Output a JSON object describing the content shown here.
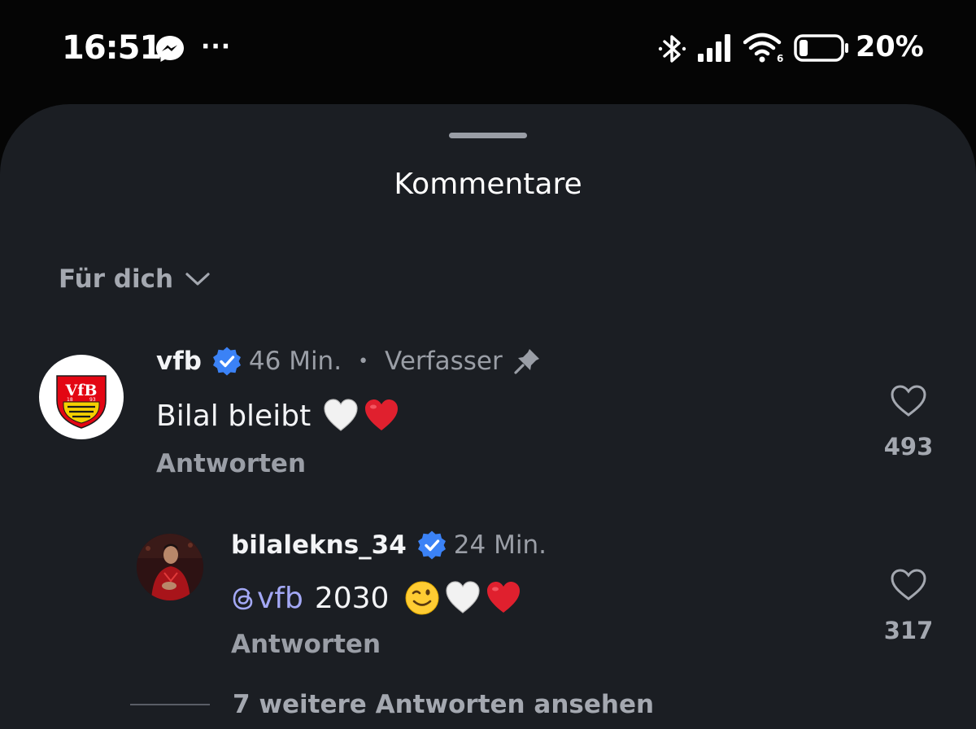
{
  "status_bar": {
    "time": "16:51",
    "more": "···",
    "battery": "20%",
    "icons": [
      "messenger-icon",
      "bluetooth-icon",
      "signal-icon",
      "wifi-icon",
      "battery-icon"
    ]
  },
  "sheet": {
    "title": "Kommentare",
    "filter_label": "Für dich"
  },
  "comments": [
    {
      "username": "vfb",
      "time": "46 Min.",
      "separator": "•",
      "role": "Verfasser",
      "text": "Bilal bleibt",
      "emojis": [
        "white-heart",
        "red-heart"
      ],
      "reply_label": "Antworten",
      "likes": "493",
      "avatar_text": {
        "top": "VfB",
        "y1": "18",
        "y2": "93"
      }
    },
    {
      "username": "bilalekns_34",
      "time": "24 Min.",
      "mention": "vfb",
      "text": "2030",
      "emojis": [
        "wink-face",
        "white-heart",
        "red-heart"
      ],
      "reply_label": "Antworten",
      "likes": "317"
    }
  ],
  "more_replies": "7 weitere Antworten ansehen",
  "colors": {
    "background": "#050505",
    "sheet": "#1b1e23",
    "verified": "#3b82f6",
    "mention": "#a3a8f5",
    "heart_red": "#e0202e",
    "muted_text": "#9a9ea6"
  }
}
